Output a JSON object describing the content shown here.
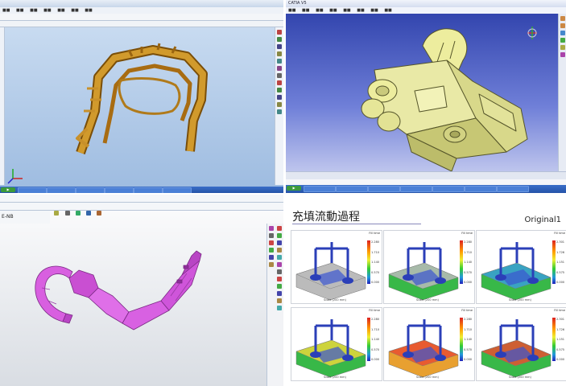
{
  "windows": {
    "top_left": {
      "title": "",
      "model_color": "#b97e16"
    },
    "top_right": {
      "title": "CATIA V5",
      "model_color": "#e6e6a0"
    },
    "bottom_left": {
      "label": "E-NB",
      "model_color": "#d85fe0"
    }
  },
  "slide": {
    "title": "充填流動過程",
    "tag": "Original1",
    "scale_label": "Scale (200 mm)",
    "legend_title": "Fill time",
    "panels": [
      {
        "ticks": [
          "2.280",
          "1.710",
          "1.140",
          "0.570",
          "0.000"
        ]
      },
      {
        "ticks": [
          "2.280",
          "1.710",
          "1.140",
          "0.570",
          "0.000"
        ]
      },
      {
        "ticks": [
          "2.301",
          "1.726",
          "1.151",
          "0.575",
          "0.000"
        ]
      },
      {
        "ticks": [
          "2.280",
          "1.710",
          "1.140",
          "0.570",
          "0.000"
        ]
      },
      {
        "ticks": [
          "2.280",
          "1.710",
          "1.140",
          "0.570",
          "0.000"
        ]
      },
      {
        "ticks": [
          "2.301",
          "1.726",
          "1.151",
          "0.575",
          "0.000"
        ]
      }
    ]
  },
  "colors": {
    "taskbar": "#2553a8",
    "catia_bg_top": "#2a3da8"
  }
}
